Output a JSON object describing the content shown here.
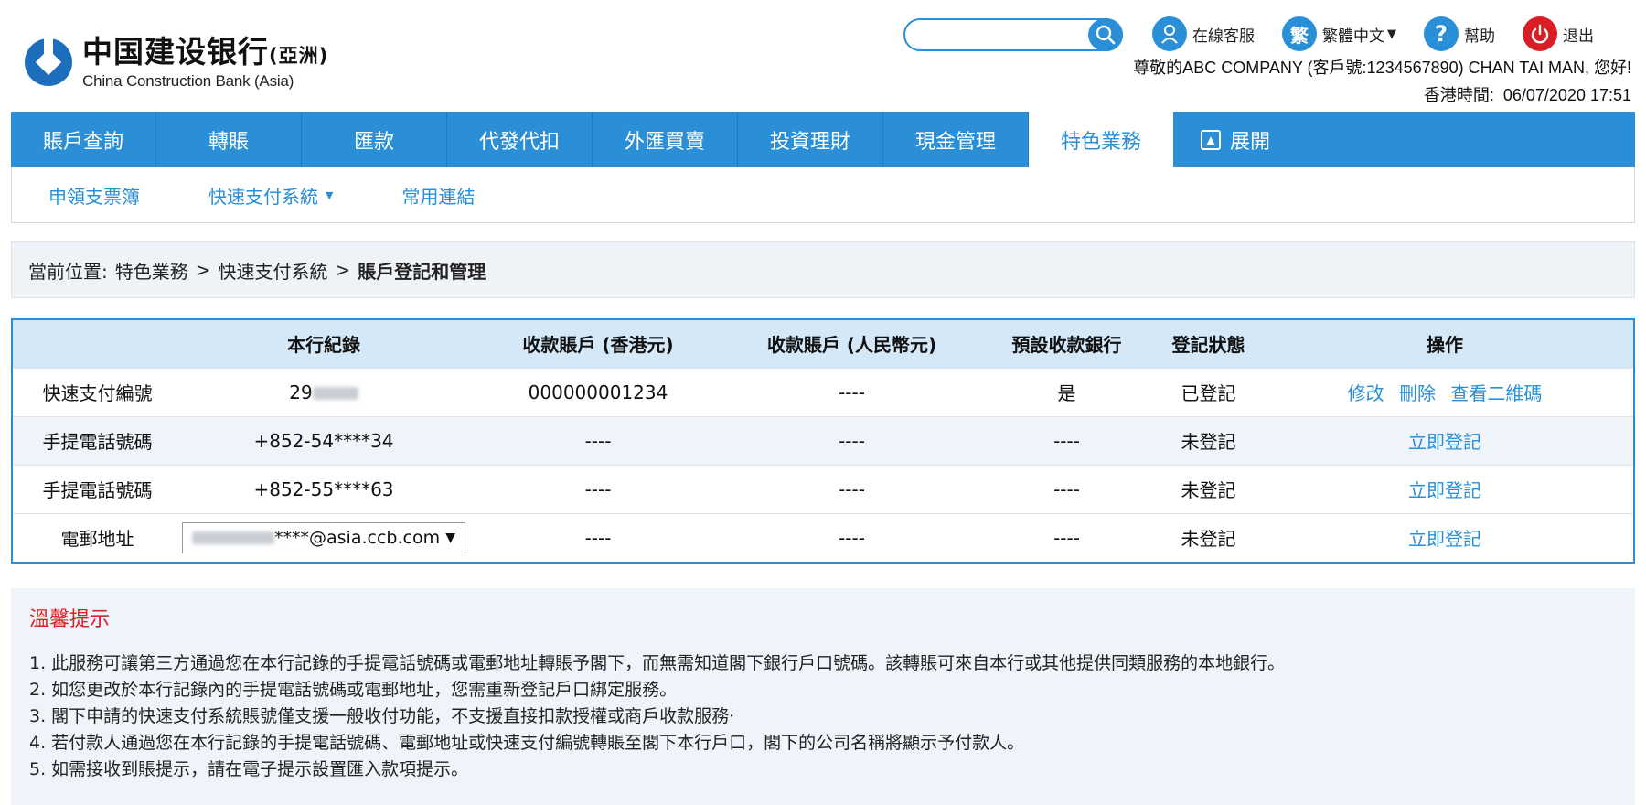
{
  "logo": {
    "name_cn": "中国建设银行",
    "name_cn_suffix": "(亞洲)",
    "name_en": "China Construction Bank (Asia)"
  },
  "search": {
    "placeholder": "",
    "icon": "search-icon"
  },
  "toplinks": {
    "support": "在線客服",
    "language": "繁體中文",
    "language_icon_char": "繁",
    "help": "幫助",
    "logout": "退出"
  },
  "greeting": "尊敬的ABC COMPANY (客戶號:1234567890) CHAN TAI MAN, 您好!",
  "time": {
    "label": "香港時間:",
    "value": "06/07/2020 17:51"
  },
  "mainnav": [
    {
      "label": "賬戶查詢"
    },
    {
      "label": "轉賬"
    },
    {
      "label": "匯款"
    },
    {
      "label": "代發代扣"
    },
    {
      "label": "外匯買賣"
    },
    {
      "label": "投資理財"
    },
    {
      "label": "現金管理"
    },
    {
      "label": "特色業務",
      "active": true
    },
    {
      "label": "展開"
    }
  ],
  "subnav": [
    {
      "label": "申領支票簿"
    },
    {
      "label": "快速支付系統"
    },
    {
      "label": "常用連結"
    }
  ],
  "breadcrumb": {
    "prefix": "當前位置:",
    "items": [
      "特色業務",
      "快速支付系統"
    ],
    "separator": ">",
    "current": "賬戶登記和管理"
  },
  "table": {
    "headers": [
      "",
      "本行紀錄",
      "收款賬戶 (香港元)",
      "收款賬戶 (人民幣元)",
      "預設收款銀行",
      "登記狀態",
      "操作"
    ],
    "rows": [
      {
        "type": "快速支付編號",
        "record": "29",
        "hkd": "000000001234",
        "rmb": "----",
        "default_bank": "是",
        "status": "已登記",
        "actions": [
          "修改",
          "刪除",
          "查看二維碼"
        ]
      },
      {
        "type": "手提電話號碼",
        "record": "+852-54****34",
        "hkd": "----",
        "rmb": "----",
        "default_bank": "----",
        "status": "未登記",
        "actions": [
          "立即登記"
        ]
      },
      {
        "type": "手提電話號碼",
        "record": "+852-55****63",
        "hkd": "----",
        "rmb": "----",
        "default_bank": "----",
        "status": "未登記",
        "actions": [
          "立即登記"
        ]
      },
      {
        "type": "電郵地址",
        "record": "****@asia.ccb.com",
        "hkd": "----",
        "rmb": "----",
        "default_bank": "----",
        "status": "未登記",
        "actions": [
          "立即登記"
        ]
      }
    ]
  },
  "tips": {
    "title": "溫馨提示",
    "items": [
      "1. 此服務可讓第三方通過您在本行記錄的手提電話號碼或電郵地址轉賬予閣下，而無需知道閣下銀行戶口號碼。該轉賬可來自本行或其他提供同類服務的本地銀行。",
      "2. 如您更改於本行記錄內的手提電話號碼或電郵地址，您需重新登記戶口綁定服務。",
      "3. 閣下申請的快速支付系統賬號僅支援一般收付功能，不支援直接扣款授權或商戶收款服務·",
      "4. 若付款人通過您在本行記錄的手提電話號碼、電郵地址或快速支付編號轉賬至閣下本行戶口，閣下的公司名稱將顯示予付款人。",
      "5. 如需接收到賬提示，請在電子提示設置匯入款項提示。"
    ]
  },
  "colors": {
    "brand_blue": "#2a8fd6",
    "logout_red": "#d81e24",
    "tip_red": "#e02020"
  }
}
